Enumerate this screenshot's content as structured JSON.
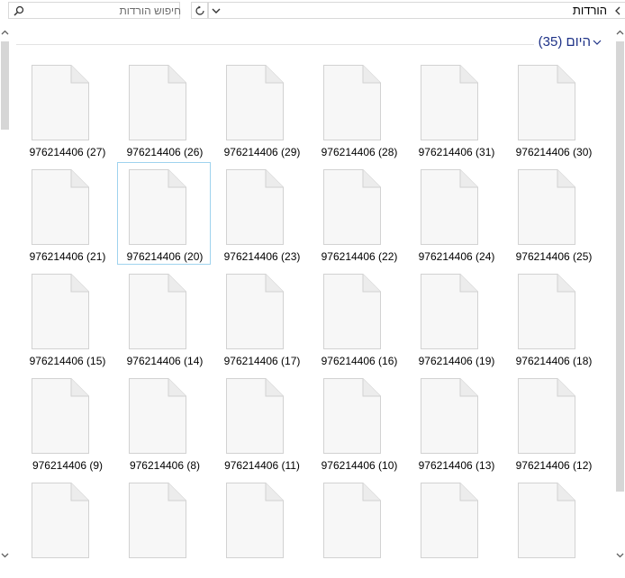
{
  "window": {
    "search": {
      "placeholder": "חיפוש הורדות",
      "value": ""
    },
    "breadcrumb": {
      "current": "הורדות"
    },
    "icons": {
      "search": "search-icon",
      "refresh": "refresh-icon",
      "address_dropdown": "chevron-down-icon",
      "breadcrumb_separator": "chevron-left-icon"
    }
  },
  "group": {
    "title": "היום (35)",
    "collapse_icon": "chevron-down-icon",
    "title_color": "#1e3287"
  },
  "files": [
    {
      "label": "976214406 (30)"
    },
    {
      "label": "976214406 (31)"
    },
    {
      "label": "976214406 (28)"
    },
    {
      "label": "976214406 (29)"
    },
    {
      "label": "976214406 (26)"
    },
    {
      "label": "976214406 (27)"
    },
    {
      "label": "976214406 (25)"
    },
    {
      "label": "976214406 (24)"
    },
    {
      "label": "976214406 (22)"
    },
    {
      "label": "976214406 (23)"
    },
    {
      "label": "976214406 (20)",
      "selected": true
    },
    {
      "label": "976214406 (21)"
    },
    {
      "label": "976214406 (18)"
    },
    {
      "label": "976214406 (19)"
    },
    {
      "label": "976214406 (16)"
    },
    {
      "label": "976214406 (17)"
    },
    {
      "label": "976214406 (14)"
    },
    {
      "label": "976214406 (15)"
    },
    {
      "label": "976214406 (12)"
    },
    {
      "label": "976214406 (13)"
    },
    {
      "label": "976214406 (10)"
    },
    {
      "label": "976214406 (11)"
    },
    {
      "label": "976214406 (8)"
    },
    {
      "label": "976214406 (9)"
    },
    {
      "label": ""
    },
    {
      "label": ""
    },
    {
      "label": ""
    },
    {
      "label": ""
    },
    {
      "label": ""
    },
    {
      "label": ""
    }
  ],
  "colors": {
    "selection_border": "#9fd3ee",
    "file_icon_fill": "#f7f7f7",
    "file_icon_stroke": "#d2d2d2"
  }
}
